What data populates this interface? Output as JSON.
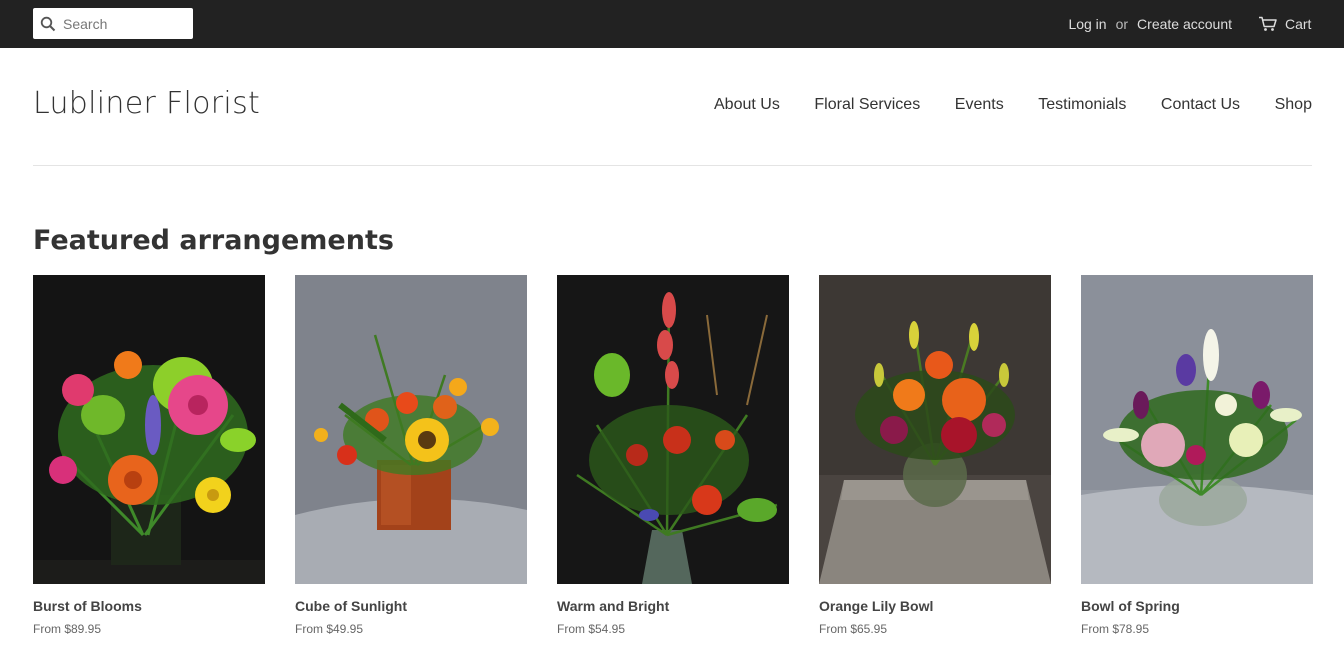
{
  "topbar": {
    "search": {
      "placeholder": "Search",
      "icon": "search-icon"
    },
    "login_label": "Log in",
    "or_label": "or",
    "create_account_label": "Create account",
    "cart_label": "Cart",
    "cart_icon": "cart-icon"
  },
  "header": {
    "logo": "Lubliner Florist",
    "nav": [
      "About Us",
      "Floral Services",
      "Events",
      "Testimonials",
      "Contact Us",
      "Shop"
    ]
  },
  "featured": {
    "title": "Featured arrangements",
    "products": [
      {
        "name": "Burst of Blooms",
        "price": "From $89.95"
      },
      {
        "name": "Cube of Sunlight",
        "price": "From $49.95"
      },
      {
        "name": "Warm and Bright",
        "price": "From $54.95"
      },
      {
        "name": "Orange Lily Bowl",
        "price": "From $65.95"
      },
      {
        "name": "Bowl of Spring",
        "price": "From $78.95"
      }
    ]
  },
  "colors": {
    "topbar_bg": "#222222",
    "text": "#333333",
    "divider": "#e4e4e4"
  }
}
